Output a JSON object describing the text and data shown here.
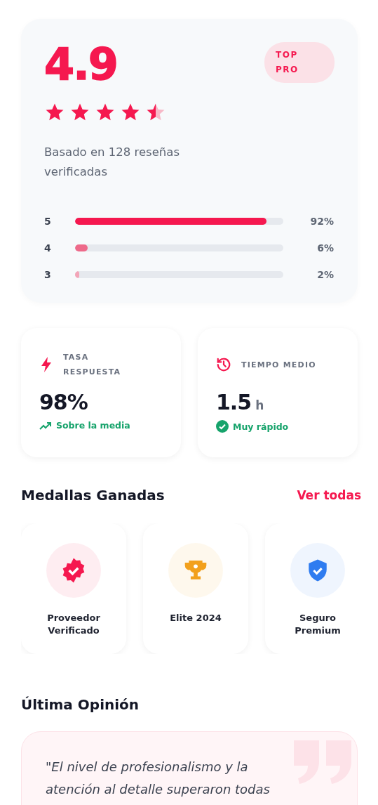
{
  "rating": {
    "score": "4.9",
    "badge": [
      "TOP",
      "PRO"
    ],
    "stars": 4.5,
    "summary": "Basado en 128 reseñas verificadas",
    "breakdown": [
      {
        "label": "5",
        "level": 0.92,
        "reading": "92%",
        "color": "#f5184f"
      },
      {
        "label": "4",
        "level": 0.06,
        "reading": "6%",
        "color": "#ee6a8a"
      },
      {
        "label": "3",
        "level": 0.02,
        "reading": "2%",
        "color": "#f3a5b8"
      }
    ]
  },
  "stats": [
    {
      "kind": "bolt",
      "title": "TASA RESPUESTA",
      "value": "98%",
      "note": {
        "kind": "trend",
        "text": "Sobre la media"
      }
    },
    {
      "kind": "clock",
      "title": "TIEMPO MEDIO",
      "value": "1.5",
      "unit": "h",
      "note": {
        "kind": "check",
        "text": "Muy rápido"
      }
    }
  ],
  "medals": {
    "title": "Medallas Ganadas",
    "link": "Ver todas",
    "items": [
      {
        "kind": "verified",
        "label": "Proveedor Verificado",
        "color": "#f5184f"
      },
      {
        "kind": "trophy",
        "label": "Elite 2024",
        "color": "#f2a01c"
      },
      {
        "kind": "shield",
        "label": "Seguro Premium",
        "color": "#2f7cf0"
      }
    ]
  },
  "review": {
    "title": "Última Opinión",
    "quote": "\"El nivel de profesionalismo y la atención al detalle superaron todas"
  }
}
